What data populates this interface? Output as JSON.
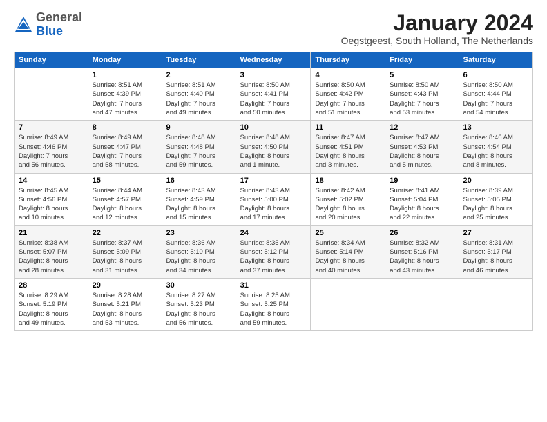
{
  "logo": {
    "general": "General",
    "blue": "Blue"
  },
  "title": "January 2024",
  "location": "Oegstgeest, South Holland, The Netherlands",
  "headers": [
    "Sunday",
    "Monday",
    "Tuesday",
    "Wednesday",
    "Thursday",
    "Friday",
    "Saturday"
  ],
  "weeks": [
    [
      {
        "day": "",
        "info": ""
      },
      {
        "day": "1",
        "info": "Sunrise: 8:51 AM\nSunset: 4:39 PM\nDaylight: 7 hours\nand 47 minutes."
      },
      {
        "day": "2",
        "info": "Sunrise: 8:51 AM\nSunset: 4:40 PM\nDaylight: 7 hours\nand 49 minutes."
      },
      {
        "day": "3",
        "info": "Sunrise: 8:50 AM\nSunset: 4:41 PM\nDaylight: 7 hours\nand 50 minutes."
      },
      {
        "day": "4",
        "info": "Sunrise: 8:50 AM\nSunset: 4:42 PM\nDaylight: 7 hours\nand 51 minutes."
      },
      {
        "day": "5",
        "info": "Sunrise: 8:50 AM\nSunset: 4:43 PM\nDaylight: 7 hours\nand 53 minutes."
      },
      {
        "day": "6",
        "info": "Sunrise: 8:50 AM\nSunset: 4:44 PM\nDaylight: 7 hours\nand 54 minutes."
      }
    ],
    [
      {
        "day": "7",
        "info": "Sunrise: 8:49 AM\nSunset: 4:46 PM\nDaylight: 7 hours\nand 56 minutes."
      },
      {
        "day": "8",
        "info": "Sunrise: 8:49 AM\nSunset: 4:47 PM\nDaylight: 7 hours\nand 58 minutes."
      },
      {
        "day": "9",
        "info": "Sunrise: 8:48 AM\nSunset: 4:48 PM\nDaylight: 7 hours\nand 59 minutes."
      },
      {
        "day": "10",
        "info": "Sunrise: 8:48 AM\nSunset: 4:50 PM\nDaylight: 8 hours\nand 1 minute."
      },
      {
        "day": "11",
        "info": "Sunrise: 8:47 AM\nSunset: 4:51 PM\nDaylight: 8 hours\nand 3 minutes."
      },
      {
        "day": "12",
        "info": "Sunrise: 8:47 AM\nSunset: 4:53 PM\nDaylight: 8 hours\nand 5 minutes."
      },
      {
        "day": "13",
        "info": "Sunrise: 8:46 AM\nSunset: 4:54 PM\nDaylight: 8 hours\nand 8 minutes."
      }
    ],
    [
      {
        "day": "14",
        "info": "Sunrise: 8:45 AM\nSunset: 4:56 PM\nDaylight: 8 hours\nand 10 minutes."
      },
      {
        "day": "15",
        "info": "Sunrise: 8:44 AM\nSunset: 4:57 PM\nDaylight: 8 hours\nand 12 minutes."
      },
      {
        "day": "16",
        "info": "Sunrise: 8:43 AM\nSunset: 4:59 PM\nDaylight: 8 hours\nand 15 minutes."
      },
      {
        "day": "17",
        "info": "Sunrise: 8:43 AM\nSunset: 5:00 PM\nDaylight: 8 hours\nand 17 minutes."
      },
      {
        "day": "18",
        "info": "Sunrise: 8:42 AM\nSunset: 5:02 PM\nDaylight: 8 hours\nand 20 minutes."
      },
      {
        "day": "19",
        "info": "Sunrise: 8:41 AM\nSunset: 5:04 PM\nDaylight: 8 hours\nand 22 minutes."
      },
      {
        "day": "20",
        "info": "Sunrise: 8:39 AM\nSunset: 5:05 PM\nDaylight: 8 hours\nand 25 minutes."
      }
    ],
    [
      {
        "day": "21",
        "info": "Sunrise: 8:38 AM\nSunset: 5:07 PM\nDaylight: 8 hours\nand 28 minutes."
      },
      {
        "day": "22",
        "info": "Sunrise: 8:37 AM\nSunset: 5:09 PM\nDaylight: 8 hours\nand 31 minutes."
      },
      {
        "day": "23",
        "info": "Sunrise: 8:36 AM\nSunset: 5:10 PM\nDaylight: 8 hours\nand 34 minutes."
      },
      {
        "day": "24",
        "info": "Sunrise: 8:35 AM\nSunset: 5:12 PM\nDaylight: 8 hours\nand 37 minutes."
      },
      {
        "day": "25",
        "info": "Sunrise: 8:34 AM\nSunset: 5:14 PM\nDaylight: 8 hours\nand 40 minutes."
      },
      {
        "day": "26",
        "info": "Sunrise: 8:32 AM\nSunset: 5:16 PM\nDaylight: 8 hours\nand 43 minutes."
      },
      {
        "day": "27",
        "info": "Sunrise: 8:31 AM\nSunset: 5:17 PM\nDaylight: 8 hours\nand 46 minutes."
      }
    ],
    [
      {
        "day": "28",
        "info": "Sunrise: 8:29 AM\nSunset: 5:19 PM\nDaylight: 8 hours\nand 49 minutes."
      },
      {
        "day": "29",
        "info": "Sunrise: 8:28 AM\nSunset: 5:21 PM\nDaylight: 8 hours\nand 53 minutes."
      },
      {
        "day": "30",
        "info": "Sunrise: 8:27 AM\nSunset: 5:23 PM\nDaylight: 8 hours\nand 56 minutes."
      },
      {
        "day": "31",
        "info": "Sunrise: 8:25 AM\nSunset: 5:25 PM\nDaylight: 8 hours\nand 59 minutes."
      },
      {
        "day": "",
        "info": ""
      },
      {
        "day": "",
        "info": ""
      },
      {
        "day": "",
        "info": ""
      }
    ]
  ]
}
